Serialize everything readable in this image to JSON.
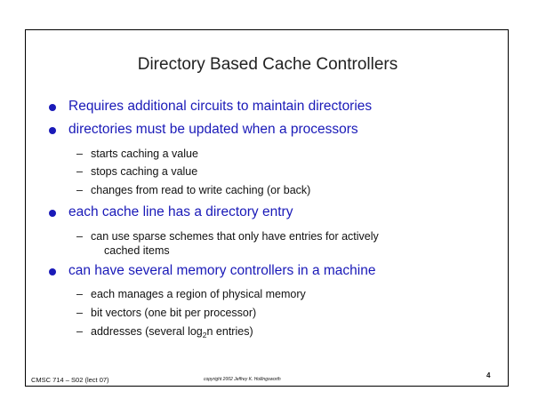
{
  "slide": {
    "title": "Directory Based Cache Controllers",
    "bullets": [
      {
        "text": "Requires additional circuits to maintain directories"
      },
      {
        "text": "directories must be updated when a processors"
      },
      {
        "text": "each cache line has a directory entry"
      },
      {
        "text": "can have several memory controllers in a machine"
      }
    ],
    "sub_bullets": {
      "updated": [
        "starts caching a value",
        "stops caching a value",
        "changes from read to write caching (or back)"
      ],
      "entry": {
        "line1": "can use sparse schemes that only have entries for actively",
        "line2": "cached items"
      },
      "controllers": [
        "each manages a region of physical memory",
        "bit vectors (one bit per processor)"
      ],
      "addresses": {
        "before": "addresses (several log",
        "sub": "2",
        "after": "n entries)"
      }
    },
    "footer": {
      "course": "CMSC 714 – S02  (lect 07)",
      "copyright": "copyright 2002  Jeffrey K. Hollingsworth",
      "page_number": "4"
    }
  }
}
